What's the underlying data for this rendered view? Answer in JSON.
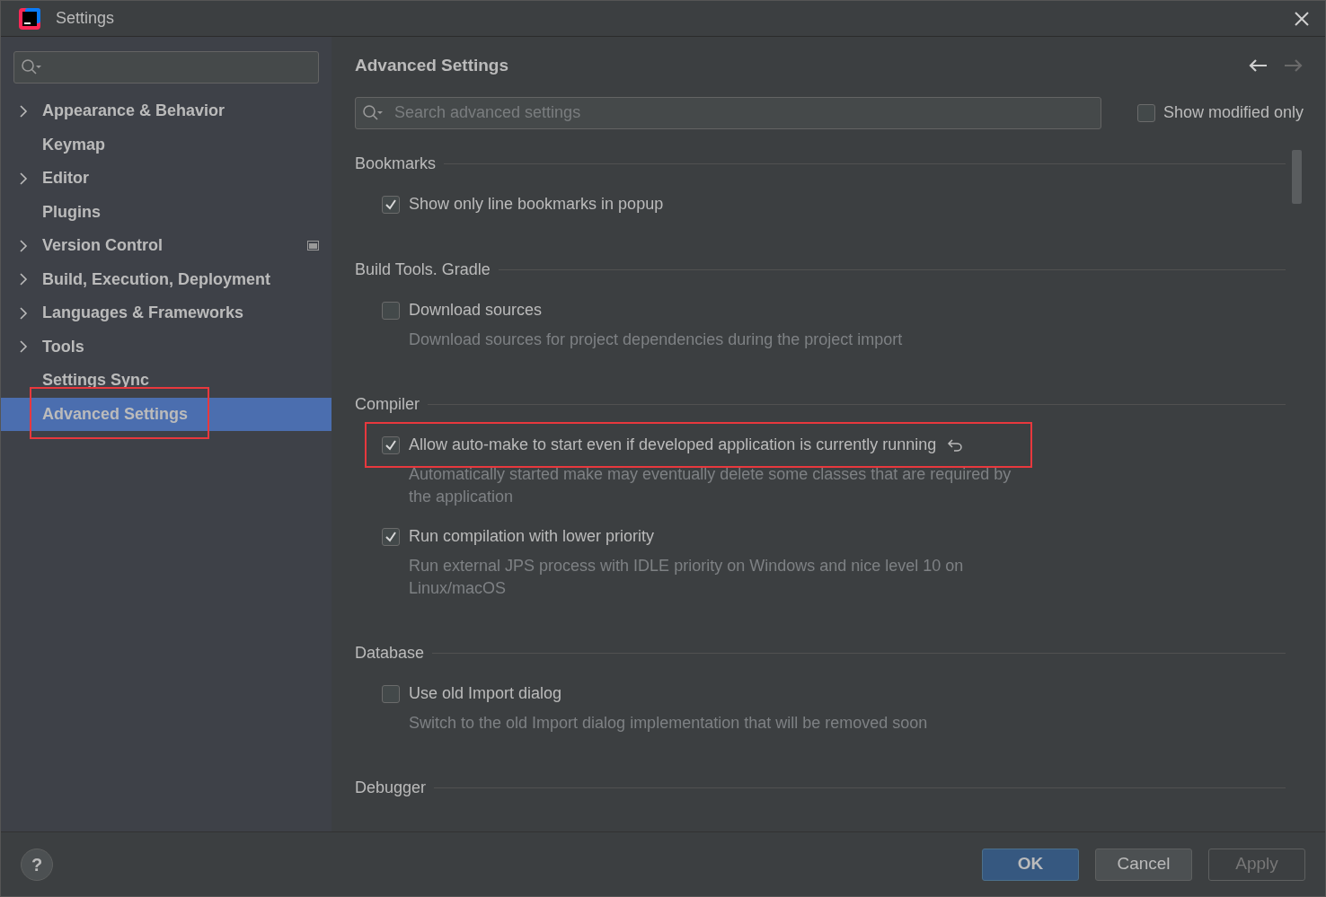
{
  "window": {
    "title": "Settings"
  },
  "sidebar": {
    "items": [
      {
        "label": "Appearance & Behavior",
        "expandable": true,
        "selected": false,
        "highlighted": false,
        "badge": false
      },
      {
        "label": "Keymap",
        "expandable": false,
        "selected": false,
        "highlighted": false,
        "badge": false
      },
      {
        "label": "Editor",
        "expandable": true,
        "selected": false,
        "highlighted": false,
        "badge": false
      },
      {
        "label": "Plugins",
        "expandable": false,
        "selected": false,
        "highlighted": false,
        "badge": false
      },
      {
        "label": "Version Control",
        "expandable": true,
        "selected": false,
        "highlighted": false,
        "badge": true
      },
      {
        "label": "Build, Execution, Deployment",
        "expandable": true,
        "selected": false,
        "highlighted": false,
        "badge": false
      },
      {
        "label": "Languages & Frameworks",
        "expandable": true,
        "selected": false,
        "highlighted": false,
        "badge": false
      },
      {
        "label": "Tools",
        "expandable": true,
        "selected": false,
        "highlighted": false,
        "badge": false
      },
      {
        "label": "Settings Sync",
        "expandable": false,
        "selected": false,
        "highlighted": false,
        "badge": false
      },
      {
        "label": "Advanced Settings",
        "expandable": false,
        "selected": true,
        "highlighted": true,
        "badge": false
      }
    ]
  },
  "main": {
    "title": "Advanced Settings",
    "search": {
      "placeholder": "Search advanced settings"
    },
    "show_modified_only": {
      "label": "Show modified only",
      "checked": false
    },
    "sections": [
      {
        "title": "Bookmarks",
        "settings": [
          {
            "label": "Show only line bookmarks in popup",
            "checked": true,
            "modified": false,
            "highlighted": false
          }
        ]
      },
      {
        "title": "Build Tools. Gradle",
        "settings": [
          {
            "label": "Download sources",
            "checked": false,
            "modified": false,
            "highlighted": false,
            "description": "Download sources for project dependencies during the project import"
          }
        ]
      },
      {
        "title": "Compiler",
        "settings": [
          {
            "label": "Allow auto-make to start even if developed application is currently running",
            "checked": true,
            "modified": true,
            "highlighted": true,
            "description": "Automatically started make may eventually delete some classes that are required by the application"
          },
          {
            "label": "Run compilation with lower priority",
            "checked": true,
            "modified": false,
            "highlighted": false,
            "description": "Run external JPS process with IDLE priority on Windows and nice level 10 on Linux/macOS"
          }
        ]
      },
      {
        "title": "Database",
        "settings": [
          {
            "label": "Use old Import dialog",
            "checked": false,
            "modified": false,
            "highlighted": false,
            "description": "Switch to the old Import dialog implementation that will be removed soon"
          }
        ]
      },
      {
        "title": "Debugger"
      }
    ]
  },
  "footer": {
    "help": "?",
    "buttons": [
      {
        "label": "OK",
        "kind": "default",
        "disabled": false
      },
      {
        "label": "Cancel",
        "kind": "normal",
        "disabled": false
      },
      {
        "label": "Apply",
        "kind": "normal",
        "disabled": true
      }
    ]
  }
}
